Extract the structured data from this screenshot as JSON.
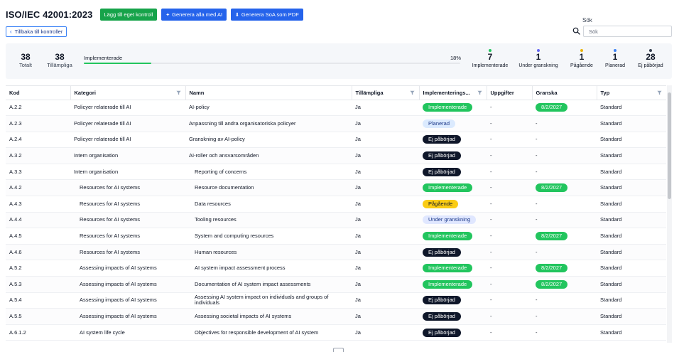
{
  "header": {
    "title": "ISO/IEC 42001:2023",
    "add_control_label": "Lägg till eget kontroll",
    "generate_all_label": "Generera alla med AI",
    "generate_soa_label": "Generera SoA som PDF",
    "back_label": "Tillbaka till kontroller"
  },
  "search": {
    "label": "Sök",
    "placeholder": "Sök"
  },
  "stats": {
    "total": {
      "value": "38",
      "label": "Totalt"
    },
    "applicable": {
      "value": "38",
      "label": "Tillämpliga"
    },
    "progress_label": "Implementerade",
    "progress_percent": "18%",
    "progress_fraction": 0.18,
    "status_counts": [
      {
        "value": "7",
        "label": "Implementerade",
        "color": "#22c55e"
      },
      {
        "value": "1",
        "label": "Under granskning",
        "color": "#6366f1"
      },
      {
        "value": "1",
        "label": "Pågående",
        "color": "#eab308"
      },
      {
        "value": "1",
        "label": "Planerad",
        "color": "#3b82f6"
      },
      {
        "value": "28",
        "label": "Ej påbörjad",
        "color": "#374151"
      }
    ]
  },
  "table": {
    "columns": {
      "kod": "Kod",
      "kategori": "Kategori",
      "namn": "Namn",
      "tillampliga": "Tillämpliga",
      "status": "Implementerings...",
      "uppgifter": "Uppgifter",
      "granska": "Granska",
      "typ": "Typ"
    },
    "rows": [
      {
        "kod": "A.2.2",
        "kategori": "Policyer relaterade till AI",
        "namn": "AI-policy",
        "tillampliga": "Ja",
        "status": "Implementerade",
        "status_type": "impl",
        "uppgifter": "-",
        "granska": "8/2/2027",
        "typ": "Standard"
      },
      {
        "kod": "A.2.3",
        "kategori": "Policyer relaterade till AI",
        "namn": "Anpassning till andra organisatoriska policyer",
        "tillampliga": "Ja",
        "status": "Planerad",
        "status_type": "plan",
        "uppgifter": "-",
        "granska": "-",
        "typ": "Standard"
      },
      {
        "kod": "A.2.4",
        "kategori": "Policyer relaterade till AI",
        "namn": "Granskning av AI-policy",
        "tillampliga": "Ja",
        "status": "Ej påbörjad",
        "status_type": "ej",
        "uppgifter": "-",
        "granska": "-",
        "typ": "Standard"
      },
      {
        "kod": "A.3.2",
        "kategori": "Intern organisation",
        "namn": "AI-roller och ansvarsområden",
        "tillampliga": "Ja",
        "status": "Ej påbörjad",
        "status_type": "ej",
        "uppgifter": "-",
        "granska": "-",
        "typ": "Standard"
      },
      {
        "kod": "A.3.3",
        "kategori": "Intern organisation",
        "namn": "Reporting of concerns",
        "tillampliga": "Ja",
        "status": "Ej påbörjad",
        "status_type": "ej",
        "uppgifter": "-",
        "granska": "-",
        "typ": "Standard"
      },
      {
        "kod": "A.4.2",
        "kategori": "Resources for AI systems",
        "namn": "Resource documentation",
        "tillampliga": "Ja",
        "status": "Implementerade",
        "status_type": "impl",
        "uppgifter": "-",
        "granska": "8/2/2027",
        "typ": "Standard"
      },
      {
        "kod": "A.4.3",
        "kategori": "Resources for AI systems",
        "namn": "Data resources",
        "tillampliga": "Ja",
        "status": "Pågående",
        "status_type": "pag",
        "uppgifter": "-",
        "granska": "-",
        "typ": "Standard"
      },
      {
        "kod": "A.4.4",
        "kategori": "Resources for AI systems",
        "namn": "Tooling resources",
        "tillampliga": "Ja",
        "status": "Under granskning",
        "status_type": "gr",
        "uppgifter": "-",
        "granska": "-",
        "typ": "Standard"
      },
      {
        "kod": "A.4.5",
        "kategori": "Resources for AI systems",
        "namn": "System and computing resources",
        "tillampliga": "Ja",
        "status": "Implementerade",
        "status_type": "impl",
        "uppgifter": "-",
        "granska": "8/2/2027",
        "typ": "Standard"
      },
      {
        "kod": "A.4.6",
        "kategori": "Resources for AI systems",
        "namn": "Human resources",
        "tillampliga": "Ja",
        "status": "Ej påbörjad",
        "status_type": "ej",
        "uppgifter": "-",
        "granska": "-",
        "typ": "Standard"
      },
      {
        "kod": "A.5.2",
        "kategori": "Assessing impacts of AI systems",
        "namn": "AI system impact assessment process",
        "tillampliga": "Ja",
        "status": "Implementerade",
        "status_type": "impl",
        "uppgifter": "-",
        "granska": "8/2/2027",
        "typ": "Standard"
      },
      {
        "kod": "A.5.3",
        "kategori": "Assessing impacts of AI systems",
        "namn": "Documentation of AI system impact assessments",
        "tillampliga": "Ja",
        "status": "Implementerade",
        "status_type": "impl",
        "uppgifter": "-",
        "granska": "8/2/2027",
        "typ": "Standard"
      },
      {
        "kod": "A.5.4",
        "kategori": "Assessing impacts of AI systems",
        "namn": "Assessing AI system impact on individuals and groups of individuals",
        "tillampliga": "Ja",
        "status": "Ej påbörjad",
        "status_type": "ej",
        "uppgifter": "-",
        "granska": "-",
        "typ": "Standard"
      },
      {
        "kod": "A.5.5",
        "kategori": "Assessing impacts of AI systems",
        "namn": "Assessing societal impacts of AI systems",
        "tillampliga": "Ja",
        "status": "Ej påbörjad",
        "status_type": "ej",
        "uppgifter": "-",
        "granska": "-",
        "typ": "Standard"
      },
      {
        "kod": "A.6.1.2",
        "kategori": "AI system life cycle",
        "namn": "Objectives for responsible development of AI system",
        "tillampliga": "Ja",
        "status": "Ej påbörjad",
        "status_type": "ej",
        "uppgifter": "-",
        "granska": "-",
        "typ": "Standard"
      }
    ]
  }
}
